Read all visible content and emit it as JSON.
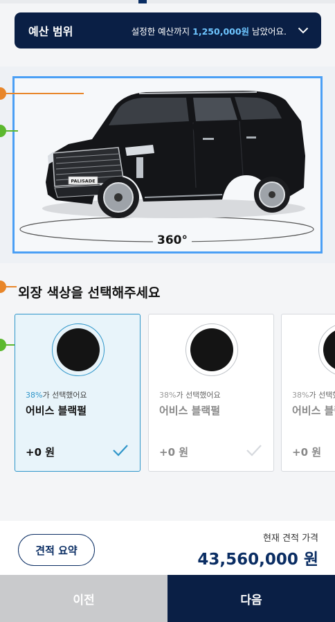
{
  "budget": {
    "title": "예산 범위",
    "message_prefix": "설정한 예산까지 ",
    "amount": "1,250,000원",
    "message_suffix": " 남았어요.",
    "expand_icon": "chevron-down-icon"
  },
  "viewer": {
    "rotation_label": "360°",
    "car_badge": "PALISADE"
  },
  "section": {
    "title": "외장 색상을 선택해주세요"
  },
  "colors": [
    {
      "percent": "38%",
      "percent_suffix": "가 선택했어요",
      "name": "어비스 블랙펄",
      "price": "+0 원",
      "swatch": "#141414",
      "selected": true
    },
    {
      "percent": "38%",
      "percent_suffix": "가 선택했어요",
      "name": "어비스 블랙펄",
      "price": "+0 원",
      "swatch": "#141414",
      "selected": false
    },
    {
      "percent": "38%",
      "percent_suffix": "가 선택했어요",
      "name": "어비스 블랙펄",
      "price": "+0 원",
      "swatch": "#141414",
      "selected": false
    }
  ],
  "summary": {
    "button_label": "견적 요약",
    "price_label": "현재 견적 가격",
    "price_value": "43,560,000 원"
  },
  "nav": {
    "prev_label": "이전",
    "next_label": "다음"
  },
  "theme": {
    "navy": "#0a1f45",
    "accent": "#2e95c9",
    "highlight": "#6ec5ff",
    "annotation_orange": "#e8862a",
    "annotation_green": "#5cb82e"
  }
}
